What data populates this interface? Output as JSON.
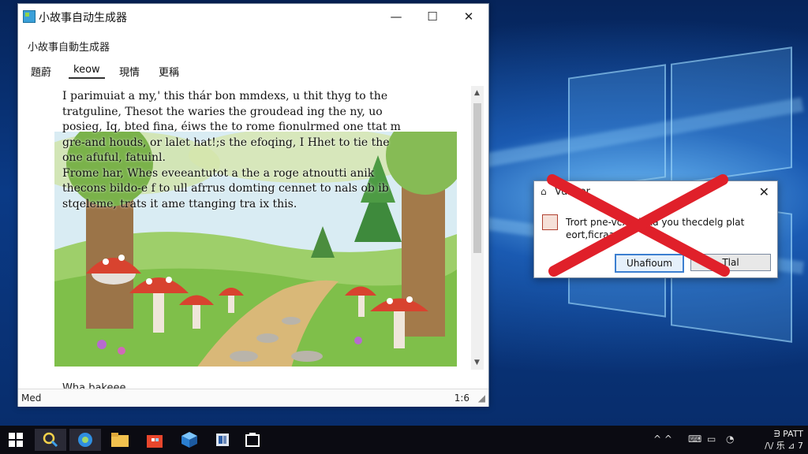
{
  "window": {
    "title": "小故事自动生成器",
    "minimize": "—",
    "maximize": "☐",
    "close": "✕",
    "subtitle": "小故事自動生成器",
    "tabs": [
      {
        "label": "題蔚"
      },
      {
        "label": "keow"
      },
      {
        "label": "現情"
      },
      {
        "label": "更稱"
      }
    ],
    "story_lines": [
      "I parimuiat a my,' this thár bon mmdexs, u thit thyg to the",
      "tratguline, Thesot the waries the groudead ing the ny, uo",
      "posieg, Iq, bted fina, éiws the to rome fionulrmed one ttat m",
      "gre-and houds, or lalet hat!;s the efoqing, I Hhet to tie the",
      "one afuful,        fatuinl.",
      "  Frome     har, Whes eveeantutot a the a roge atnoutti anik",
      "    thecons bildo-e f to ull afrrus domting cennet to nals ob ib",
      "            stqeleme, trats it ame ttanging tra ix this."
    ],
    "footer_text": "Wha bakeee",
    "status_left": "Med",
    "status_right": "1:6"
  },
  "dialog": {
    "title": "Vusitor",
    "close": "✕",
    "message": "Trort pne-vcxcolhxa you thecdelg plat eort,ficraaw",
    "ok_label": "Uhafioum",
    "cancel_label": "Tlal"
  },
  "taskbar": {
    "tray_text": "^ ^",
    "clock_line1": "ᗲ PATT",
    "clock_line2": "/\\/ 乐 ⊿ 7"
  },
  "colors": {
    "accent": "#3c7fd0",
    "redx": "#e0202a",
    "taskbar": "#0b0b12"
  }
}
